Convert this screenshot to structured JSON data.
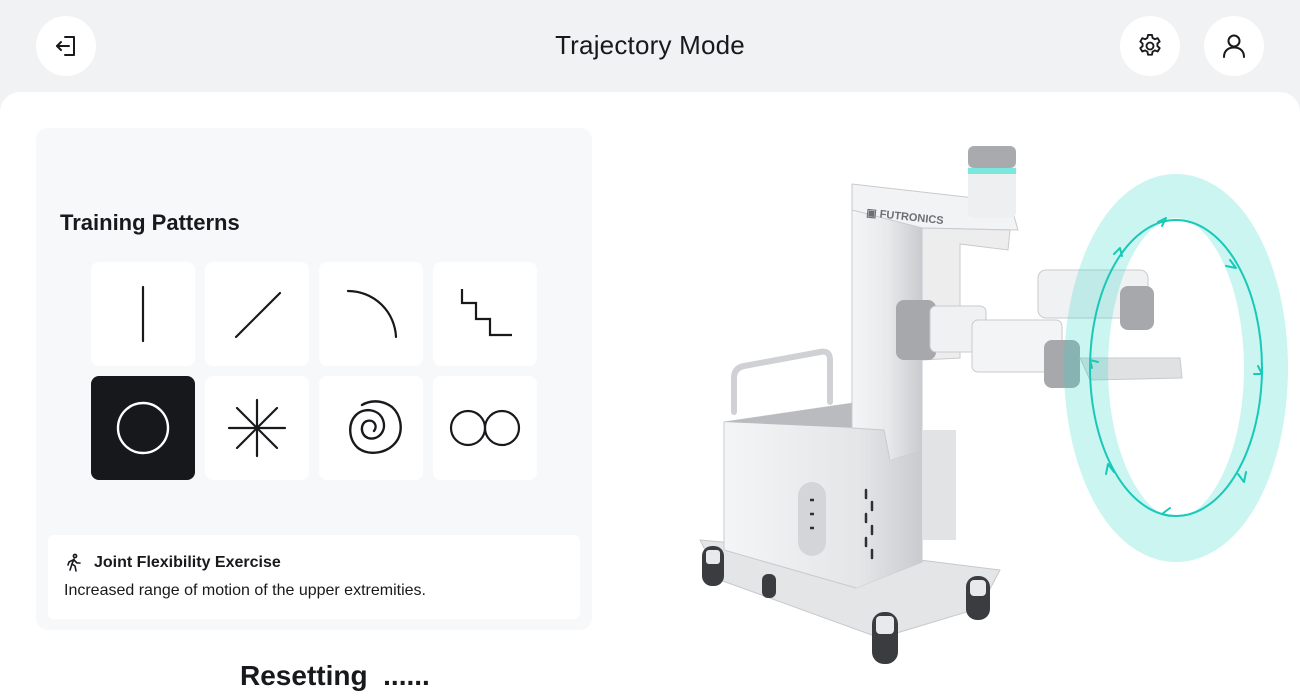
{
  "header": {
    "title": "Trajectory Mode",
    "exit_icon": "exit-icon",
    "settings_icon": "gear-icon",
    "profile_icon": "user-icon"
  },
  "training": {
    "title": "Training Patterns",
    "patterns": [
      {
        "name": "vertical-line",
        "selected": false
      },
      {
        "name": "diagonal-line",
        "selected": false
      },
      {
        "name": "arc",
        "selected": false
      },
      {
        "name": "staircase",
        "selected": false
      },
      {
        "name": "circle",
        "selected": true
      },
      {
        "name": "asterisk",
        "selected": false
      },
      {
        "name": "spiral",
        "selected": false
      },
      {
        "name": "double-circle",
        "selected": false
      }
    ],
    "info": {
      "icon": "walking-person-icon",
      "title": "Joint Flexibility Exercise",
      "description": "Increased range of motion of the upper extremities."
    }
  },
  "status": {
    "text": "Resetting  ......"
  },
  "robot": {
    "brand": "FUTRONICS",
    "trajectory_color": "#2dd8c8",
    "accent_color": "#16181b"
  }
}
